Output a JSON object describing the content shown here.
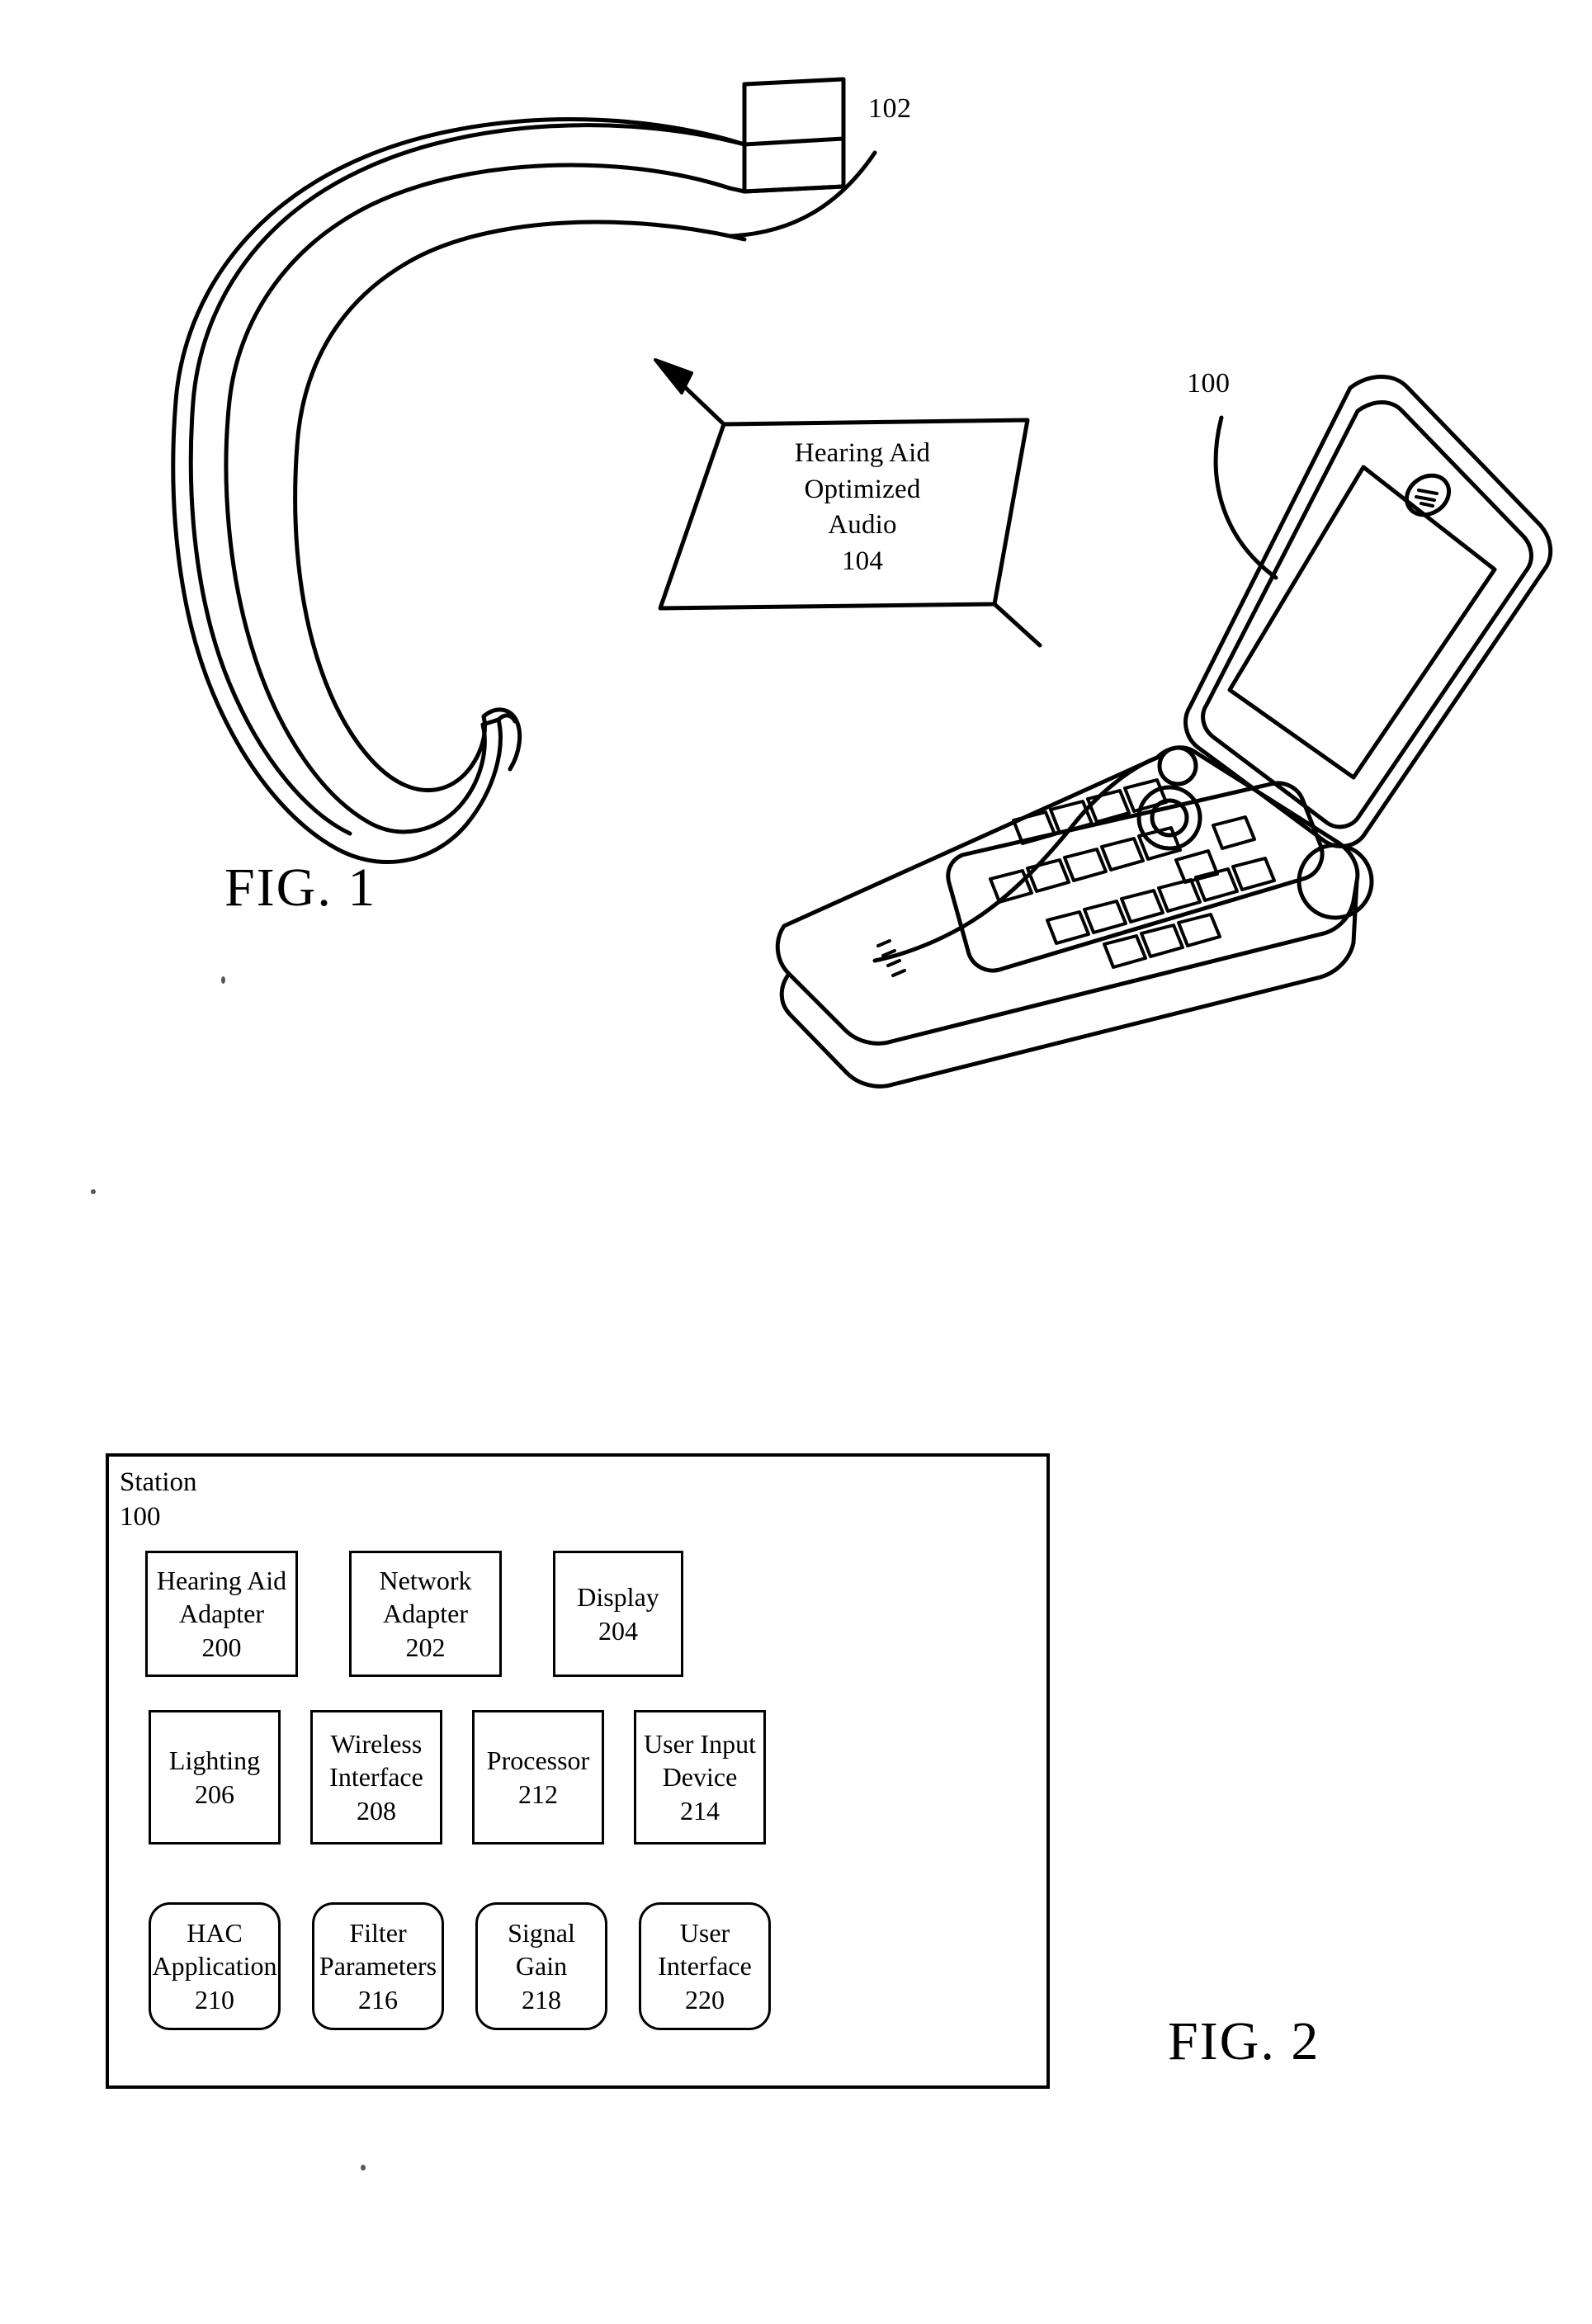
{
  "page": {
    "background": "#ffffff",
    "ink": "#000000"
  },
  "figure1": {
    "caption": "FIG. 1",
    "hearing_aid": {
      "ref": "102",
      "name": "hearing-aid-earhook"
    },
    "station_device": {
      "ref": "100",
      "name": "flip-phone-station"
    },
    "flow_label": {
      "ref": "104",
      "lines": [
        "Hearing Aid",
        "Optimized",
        "Audio"
      ],
      "line1": "Hearing Aid",
      "line2": "Optimized",
      "line3": "Audio",
      "line4": "104"
    }
  },
  "figure2": {
    "caption": "FIG. 2",
    "container": {
      "title": "Station",
      "ref": "100"
    },
    "rows": [
      {
        "shape": "rect",
        "blocks": [
          {
            "lines": [
              "Hearing Aid",
              "Adapter"
            ],
            "ref": "200",
            "name": "hearing-aid-adapter"
          },
          {
            "lines": [
              "Network",
              "Adapter"
            ],
            "ref": "202",
            "name": "network-adapter"
          },
          {
            "lines": [
              "Display"
            ],
            "ref": "204",
            "name": "display"
          }
        ]
      },
      {
        "shape": "rect",
        "blocks": [
          {
            "lines": [
              "Lighting"
            ],
            "ref": "206",
            "name": "lighting"
          },
          {
            "lines": [
              "Wireless",
              "Interface"
            ],
            "ref": "208",
            "name": "wireless-interface"
          },
          {
            "lines": [
              "Processor"
            ],
            "ref": "212",
            "name": "processor"
          },
          {
            "lines": [
              "User Input",
              "Device"
            ],
            "ref": "214",
            "name": "user-input-device"
          }
        ]
      },
      {
        "shape": "rounded-rect",
        "blocks": [
          {
            "lines": [
              "HAC",
              "Application"
            ],
            "ref": "210",
            "name": "hac-application"
          },
          {
            "lines": [
              "Filter",
              "Parameters"
            ],
            "ref": "216",
            "name": "filter-parameters"
          },
          {
            "lines": [
              "Signal",
              "Gain"
            ],
            "ref": "218",
            "name": "signal-gain"
          },
          {
            "lines": [
              "User",
              "Interface"
            ],
            "ref": "220",
            "name": "user-interface"
          }
        ]
      }
    ],
    "b200_l1": "Hearing Aid",
    "b200_l2": "Adapter",
    "b200_ref": "200",
    "b202_l1": "Network",
    "b202_l2": "Adapter",
    "b202_ref": "202",
    "b204_l1": "Display",
    "b204_ref": "204",
    "b206_l1": "Lighting",
    "b206_ref": "206",
    "b208_l1": "Wireless",
    "b208_l2": "Interface",
    "b208_ref": "208",
    "b212_l1": "Processor",
    "b212_ref": "212",
    "b214_l1": "User Input",
    "b214_l2": "Device",
    "b214_ref": "214",
    "b210_l1": "HAC",
    "b210_l2": "Application",
    "b210_ref": "210",
    "b216_l1": "Filter",
    "b216_l2": "Parameters",
    "b216_ref": "216",
    "b218_l1": "Signal",
    "b218_l2": "Gain",
    "b218_ref": "218",
    "b220_l1": "User",
    "b220_l2": "Interface",
    "b220_ref": "220"
  }
}
